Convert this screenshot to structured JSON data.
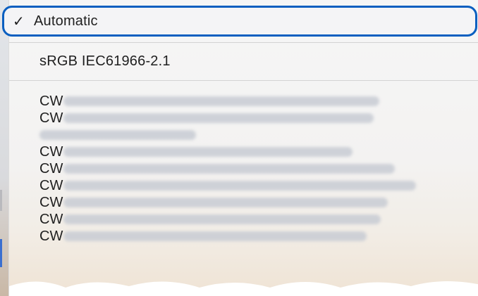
{
  "menu": {
    "selected": {
      "check": "✓",
      "label": "Automatic"
    },
    "srgb_label": "sRGB IEC61966-2.1",
    "profiles": [
      {
        "prefix": "CW",
        "blur_width": 448
      },
      {
        "prefix": "CW",
        "blur_width": 440
      },
      {
        "prefix": "",
        "blur_width": 222
      },
      {
        "prefix": "CW",
        "blur_width": 410
      },
      {
        "prefix": "CW",
        "blur_width": 470
      },
      {
        "prefix": "CW",
        "blur_width": 500
      },
      {
        "prefix": "CW",
        "blur_width": 460
      },
      {
        "prefix": "CW",
        "blur_width": 450
      },
      {
        "prefix": "CW",
        "blur_width": 430
      }
    ]
  },
  "colors": {
    "selection_border": "#0a5fc0",
    "separator": "#d3d3d3",
    "text": "#1f1f1f"
  }
}
